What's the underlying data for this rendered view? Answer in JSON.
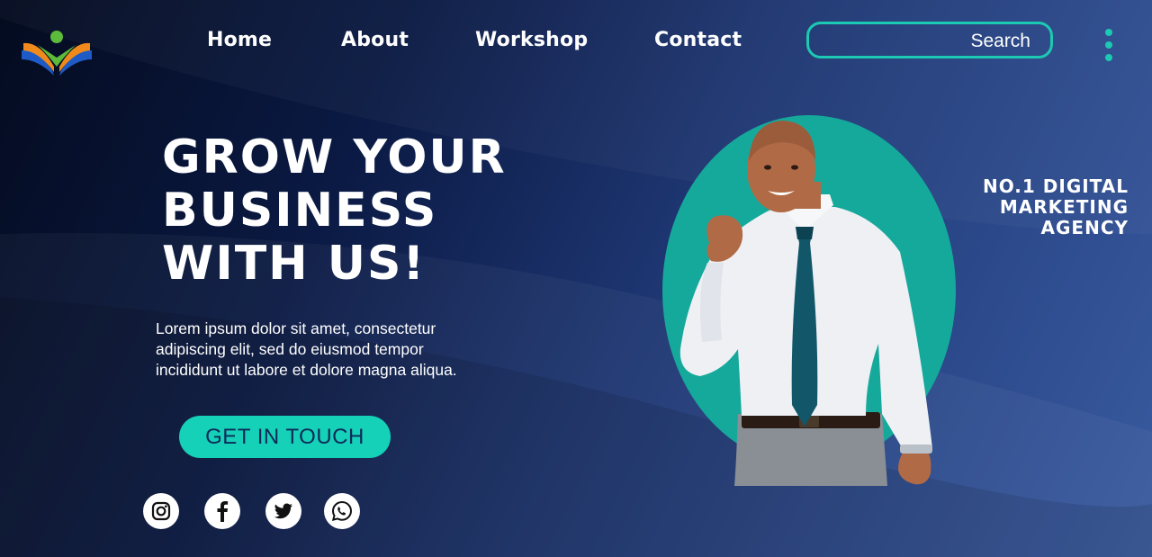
{
  "nav": {
    "items": [
      {
        "label": "Home"
      },
      {
        "label": "About"
      },
      {
        "label": "Workshop"
      },
      {
        "label": "Contact"
      }
    ]
  },
  "search": {
    "label": "Search"
  },
  "menu": {
    "icon": "kebab-menu-icon"
  },
  "logo": {
    "icon": "book-person-logo-icon"
  },
  "hero": {
    "headline": [
      "GROW YOUR",
      "BUSINESS",
      "WITH US!"
    ],
    "body": [
      "Lorem ipsum dolor sit amet, consectetur",
      "adipiscing elit, sed do eiusmod tempor",
      "incididunt ut labore et dolore magna aliqua."
    ],
    "cta_label": "GET IN TOUCH",
    "tagline": [
      "NO.1 DIGITAL",
      "MARKETING",
      "AGENCY"
    ]
  },
  "social": [
    {
      "icon": "instagram-icon"
    },
    {
      "icon": "facebook-icon"
    },
    {
      "icon": "twitter-icon"
    },
    {
      "icon": "whatsapp-icon"
    }
  ],
  "colors": {
    "accent": "#1cc9b2",
    "background_dark": "#040b1f",
    "background_light": "#3a5ba0",
    "oval": "#15a99b",
    "text": "#ffffff"
  }
}
